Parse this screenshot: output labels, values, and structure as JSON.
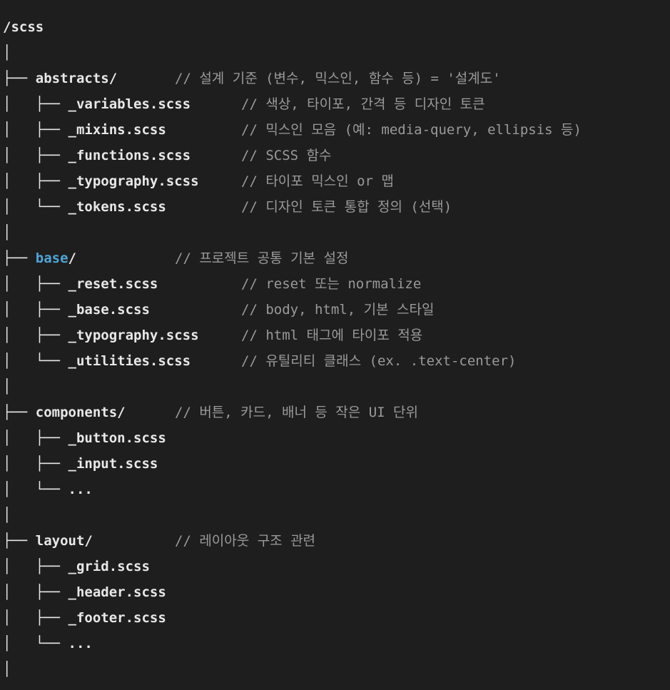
{
  "root": "/scss",
  "connector_pipe": "│",
  "lines": [
    {
      "prefix": "├── ",
      "name": "abstracts",
      "slash": "/",
      "comment": "// 설계 기준 (변수, 믹스인, 함수 등) = '설계도'"
    },
    {
      "prefix": "│   ├── ",
      "name": "_variables.scss",
      "comment": "// 색상, 타이포, 간격 등 디자인 토큰"
    },
    {
      "prefix": "│   ├── ",
      "name": "_mixins.scss",
      "comment": "// 믹스인 모음 (예: media-query, ellipsis 등)"
    },
    {
      "prefix": "│   ├── ",
      "name": "_functions.scss",
      "comment": "// SCSS 함수"
    },
    {
      "prefix": "│   ├── ",
      "name": "_typography.scss",
      "comment": "// 타이포 믹스인 or 맵"
    },
    {
      "prefix": "│   └── ",
      "name": "_tokens.scss",
      "comment": "// 디자인 토큰 통합 정의 (선택)"
    },
    {
      "prefix": "│",
      "name": "",
      "comment": ""
    },
    {
      "prefix": "├── ",
      "name": "base",
      "slash": "/",
      "comment": "// 프로젝트 공통 기본 설정"
    },
    {
      "prefix": "│   ├── ",
      "name": "_reset.scss",
      "comment": "// reset 또는 normalize"
    },
    {
      "prefix": "│   ├── ",
      "name": "_base.scss",
      "comment": "// body, html, 기본 스타일"
    },
    {
      "prefix": "│   ├── ",
      "name": "_typography.scss",
      "comment": "// html 태그에 타이포 적용"
    },
    {
      "prefix": "│   └── ",
      "name": "_utilities.scss",
      "comment": "// 유틸리티 클래스 (ex. .text-center)"
    },
    {
      "prefix": "│",
      "name": "",
      "comment": ""
    },
    {
      "prefix": "├── ",
      "name": "components",
      "slash": "/",
      "comment": "// 버튼, 카드, 배너 등 작은 UI 단위"
    },
    {
      "prefix": "│   ├── ",
      "name": "_button.scss",
      "comment": ""
    },
    {
      "prefix": "│   ├── ",
      "name": "_input.scss",
      "comment": ""
    },
    {
      "prefix": "│   └── ",
      "name": "...",
      "comment": ""
    },
    {
      "prefix": "│",
      "name": "",
      "comment": ""
    },
    {
      "prefix": "├── ",
      "name": "layout",
      "slash": "/",
      "comment": "// 레이아웃 구조 관련"
    },
    {
      "prefix": "│   ├── ",
      "name": "_grid.scss",
      "comment": ""
    },
    {
      "prefix": "│   ├── ",
      "name": "_header.scss",
      "comment": ""
    },
    {
      "prefix": "│   ├── ",
      "name": "_footer.scss",
      "comment": ""
    },
    {
      "prefix": "│   └── ",
      "name": "...",
      "comment": ""
    },
    {
      "prefix": "│",
      "name": "",
      "comment": ""
    }
  ],
  "colors": {
    "background": "#1e1e1e",
    "text": "#e8e8e8",
    "comment": "#9a9a9a",
    "highlight": "#4fa6d8"
  }
}
